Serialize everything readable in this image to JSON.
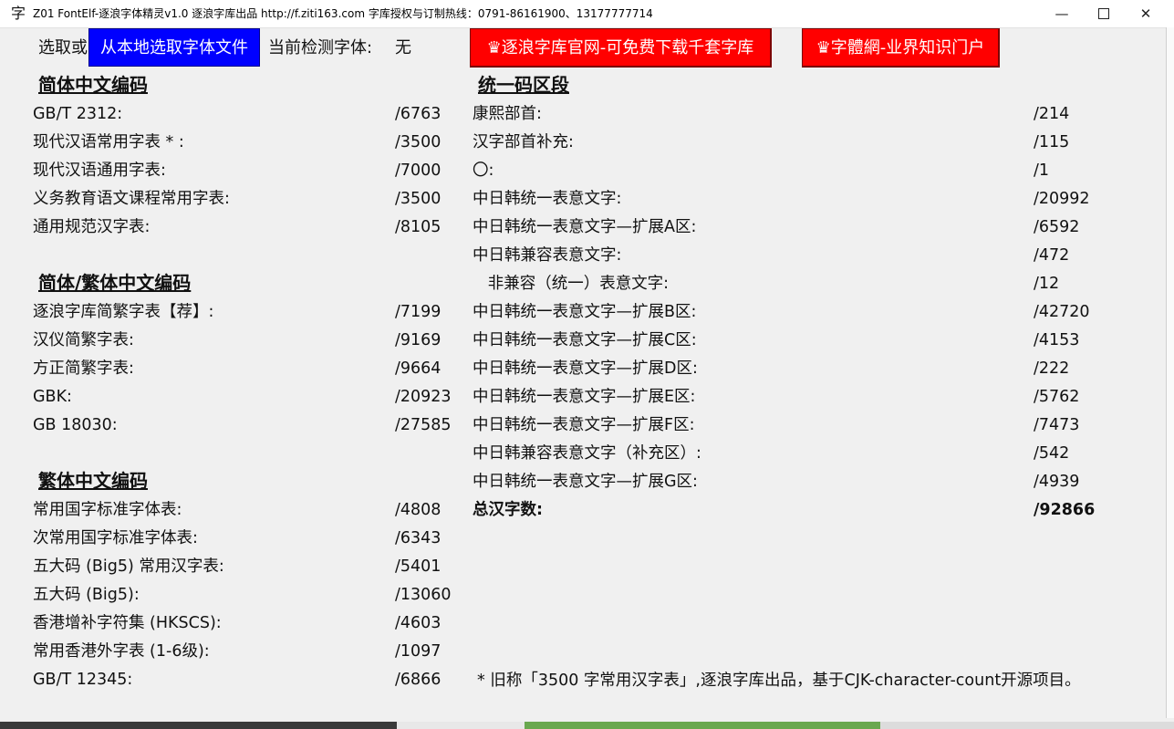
{
  "window": {
    "app_icon": "字",
    "title": "Z01 FontElf-逐浪字体精灵v1.0 逐浪字库出品 http://f.ziti163.com 字库授权与订制热线：0791-86161900、13177777714",
    "minimize_glyph": "—",
    "close_glyph": "✕"
  },
  "toolbar": {
    "select_prefix": "选取或",
    "local_button": "从本地选取字体文件",
    "detect_label": "当前检测字体:",
    "detect_value": "无",
    "site_button": "♛逐浪字库官网-可免费下载千套字库",
    "zitiw_button": "♛字體網-业界知识门户"
  },
  "simplified": {
    "title": "简体中文编码",
    "rows": [
      {
        "label": "GB/T 2312:",
        "value": "/6763"
      },
      {
        "label": "现代汉语常用字表 * :",
        "value": "/3500"
      },
      {
        "label": "现代汉语通用字表:",
        "value": "/7000"
      },
      {
        "label": "义务教育语文课程常用字表:",
        "value": "/3500"
      },
      {
        "label": "通用规范汉字表:",
        "value": "/8105"
      }
    ]
  },
  "mixed": {
    "title": "简体/繁体中文编码",
    "rows": [
      {
        "label": "逐浪字库简繁字表【荐】:",
        "value": "/7199"
      },
      {
        "label": "汉仪简繁字表:",
        "value": "/9169"
      },
      {
        "label": "方正简繁字表:",
        "value": "/9664"
      },
      {
        "label": "GBK:",
        "value": "/20923"
      },
      {
        "label": "GB 18030:",
        "value": "/27585"
      }
    ]
  },
  "traditional": {
    "title": "繁体中文编码",
    "rows": [
      {
        "label": "常用国字标准字体表:",
        "value": "/4808"
      },
      {
        "label": "次常用国字标准字体表:",
        "value": "/6343"
      },
      {
        "label": "五大码 (Big5) 常用汉字表:",
        "value": "/5401"
      },
      {
        "label": "五大码 (Big5):",
        "value": "/13060"
      },
      {
        "label": "香港增补字符集 (HKSCS):",
        "value": "/4603"
      },
      {
        "label": "常用香港外字表 (1-6级):",
        "value": "/1097"
      },
      {
        "label": "GB/T 12345:",
        "value": "/6866"
      }
    ]
  },
  "unicode": {
    "title": "统一码区段",
    "rows": [
      {
        "label": "康熙部首:",
        "value": "/214"
      },
      {
        "label": "汉字部首补充:",
        "value": "/115"
      },
      {
        "label": "〇:",
        "value": "/1"
      },
      {
        "label": "中日韩统一表意文字:",
        "value": "/20992"
      },
      {
        "label": "中日韩统一表意文字—扩展A区:",
        "value": "/6592"
      },
      {
        "label": "中日韩兼容表意文字:",
        "value": "/472"
      },
      {
        "label": "   非兼容（统一）表意文字:",
        "value": "/12"
      },
      {
        "label": "中日韩统一表意文字—扩展B区:",
        "value": "/42720"
      },
      {
        "label": "中日韩统一表意文字—扩展C区:",
        "value": "/4153"
      },
      {
        "label": "中日韩统一表意文字—扩展D区:",
        "value": "/222"
      },
      {
        "label": "中日韩统一表意文字—扩展E区:",
        "value": "/5762"
      },
      {
        "label": "中日韩统一表意文字—扩展F区:",
        "value": "/7473"
      },
      {
        "label": "中日韩兼容表意文字（补充区）:",
        "value": "/542"
      },
      {
        "label": "中日韩统一表意文字—扩展G区:",
        "value": "/4939"
      }
    ],
    "total": {
      "label": "总汉字数:",
      "value": "/92866"
    }
  },
  "footnote": "* 旧称「3500 字常用汉字表」,逐浪字库出品，基于CJK-character-count开源项目。"
}
